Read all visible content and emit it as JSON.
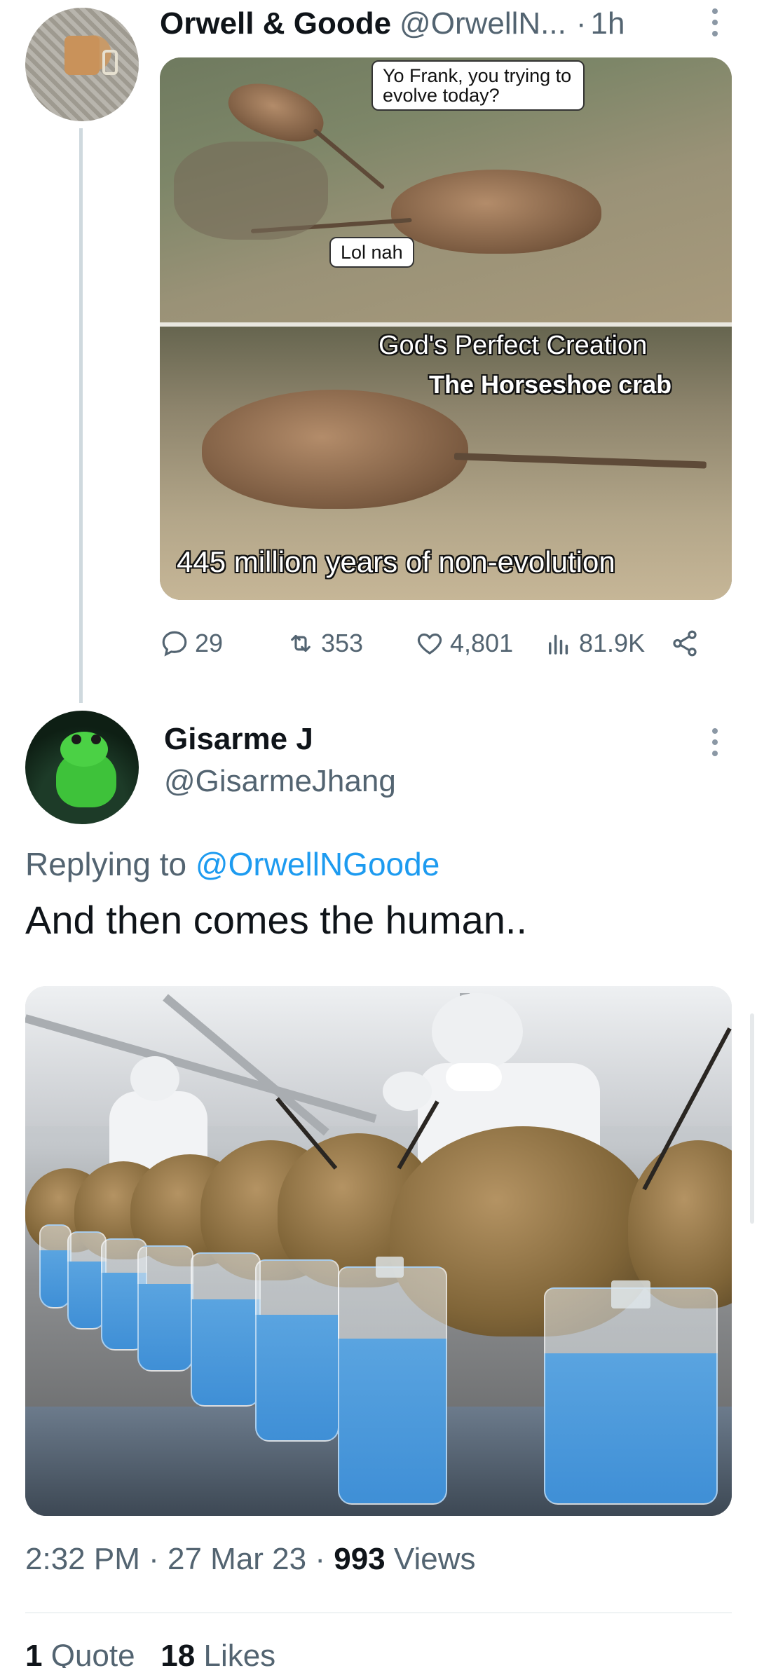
{
  "parent_tweet": {
    "display_name": "Orwell & Goode",
    "handle": "@OrwellN...",
    "separator": "·",
    "time": "1h",
    "meme": {
      "bubble_top": "Yo Frank, you trying to evolve today?",
      "bubble_mid": "Lol nah",
      "caption_line1": "God's Perfect Creation",
      "caption_line2": "The Horseshoe crab",
      "caption_bottom": "445 million years of non-evolution"
    },
    "stats": {
      "replies": "29",
      "retweets": "353",
      "likes": "4,801",
      "views": "81.9K"
    }
  },
  "reply_tweet": {
    "display_name": "Gisarme J",
    "handle": "@GisarmeJhang",
    "replying_prefix": "Replying to",
    "replying_to": "@OrwellNGoode",
    "text": "And then comes the human..",
    "meta": {
      "time": "2:32 PM",
      "dot1": "·",
      "date": "27 Mar 23",
      "dot2": "·",
      "views_count": "993",
      "views_label": "Views"
    },
    "engagement": {
      "quotes_count": "1",
      "quotes_label": "Quote",
      "likes_count": "18",
      "likes_label": "Likes"
    }
  },
  "colors": {
    "text_primary": "#0f1419",
    "text_secondary": "#536471",
    "link": "#1d9bf0",
    "thread_line": "#cfd9de"
  },
  "icons": [
    "reply-icon",
    "retweet-icon",
    "like-icon",
    "views-icon",
    "share-icon",
    "more-icon"
  ]
}
